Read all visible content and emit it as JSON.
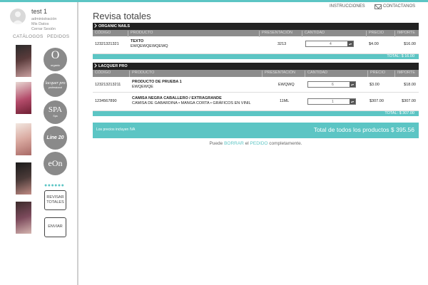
{
  "user": {
    "name": "test 1",
    "links": [
      "administración",
      "Mis Datos",
      "Cerrar Sesión"
    ]
  },
  "sidebar": {
    "tab_catalogs": "CATÁLOGOS",
    "tab_orders": "PEDIDOS",
    "brands": [
      {
        "label": "O",
        "sub": "organic"
      },
      {
        "label": "lacquer pro",
        "sub": "professional"
      },
      {
        "label": "SPA",
        "sub": "Spa"
      },
      {
        "label": "Line 20",
        "sub": ""
      },
      {
        "label": "eOn",
        "sub": ""
      }
    ],
    "dots": "●●●●●●",
    "btn_review": "REVISAR TOTALES",
    "btn_send": "ENVIAR"
  },
  "header": {
    "instructions": "INSTRUCCIONES",
    "contact": "CONTACTANOS"
  },
  "title": "Revisa totales",
  "columns": [
    "CÓDIGO",
    "PRODUCTO",
    "PRESENTACIÓN",
    "CANTIDAD",
    "PRECIO",
    "IMPORTE"
  ],
  "sections": [
    {
      "name": "ORGANIC NAILS",
      "rows": [
        {
          "code": "12321321321",
          "product": "TEXTO",
          "desc": "EWQEWQEWQEWQ",
          "pres": "3213",
          "qty": "4",
          "price": "$4.00",
          "amount": "$16.00"
        }
      ],
      "total": "TOTAL: $ 16.00"
    },
    {
      "name": "LACQUER PRO",
      "rows": [
        {
          "code": "123213213211",
          "product": "PRODUCTO DE PRUEBA 1",
          "desc": "EWQEWQE",
          "pres": "EWQWQ",
          "qty": "6",
          "price": "$3.00",
          "amount": "$18.00"
        },
        {
          "code": "1234567890",
          "product": "CAMISA NEGRA CABALLERO / EXTRAGRANDE",
          "desc": "CAMISA DE GABARDINA • MANGA CORTA • GRÁFICOS EN VINIL",
          "pres": "11ML",
          "qty": "1",
          "price": "$307.00",
          "amount": "$307.00"
        }
      ],
      "total": "TOTAL: $ 307.00"
    }
  ],
  "summary": {
    "note": "Los precios incluyen IVA",
    "total": "Total de todos los productos $ 395.56"
  },
  "footer": {
    "pre": "Puede ",
    "link1": "BORRAR",
    "mid": " el ",
    "link2": "PEDIDO",
    "post": " completamente."
  },
  "colors": {
    "accent": "#5cc5c4",
    "header": "#222222",
    "col_head": "#8c8c8c"
  }
}
